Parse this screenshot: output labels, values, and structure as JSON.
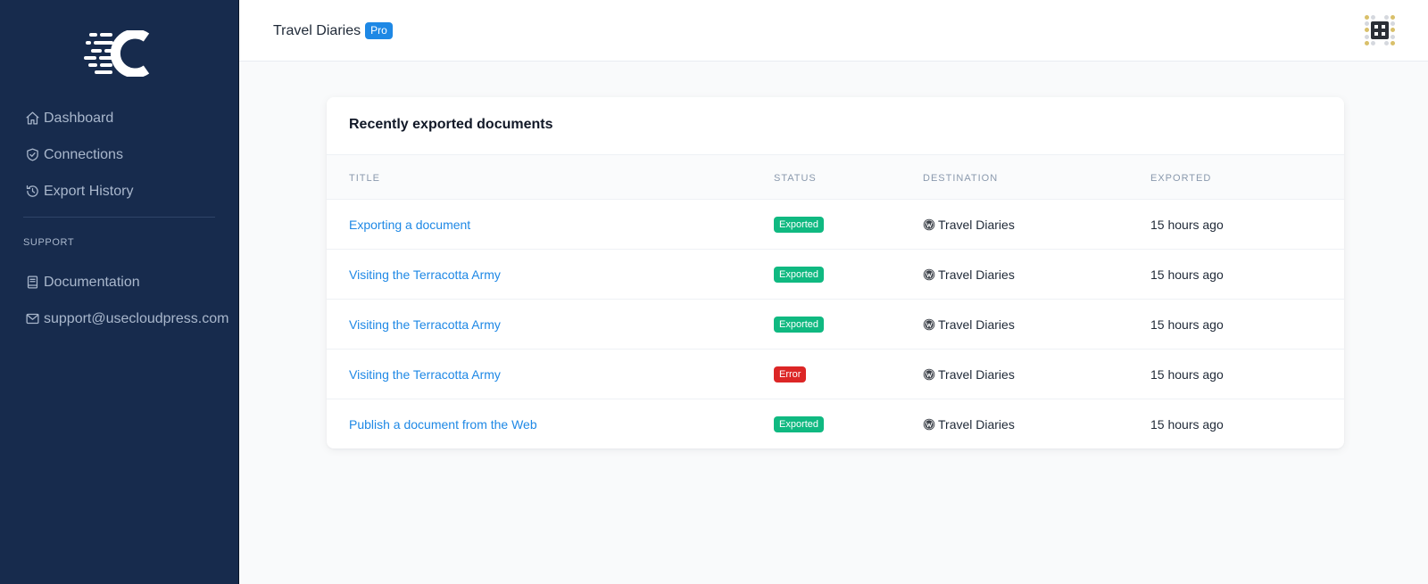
{
  "sidebar": {
    "nav": [
      {
        "label": "Dashboard",
        "icon": "home-icon"
      },
      {
        "label": "Connections",
        "icon": "shield-check-icon"
      },
      {
        "label": "Export History",
        "icon": "history-icon"
      }
    ],
    "support_label": "SUPPORT",
    "support": [
      {
        "label": "Documentation",
        "icon": "book-icon"
      },
      {
        "label": "support@usecloudpress.com",
        "icon": "mail-icon"
      }
    ]
  },
  "header": {
    "site_name": "Travel Diaries",
    "plan_badge": "Pro"
  },
  "card": {
    "title": "Recently exported documents",
    "columns": {
      "title": "TITLE",
      "status": "STATUS",
      "destination": "DESTINATION",
      "exported": "EXPORTED"
    },
    "rows": [
      {
        "title": "Exporting a document",
        "status": "Exported",
        "destination": "Travel Diaries",
        "exported": "15 hours ago"
      },
      {
        "title": "Visiting the Terracotta Army",
        "status": "Exported",
        "destination": "Travel Diaries",
        "exported": "15 hours ago"
      },
      {
        "title": "Visiting the Terracotta Army",
        "status": "Exported",
        "destination": "Travel Diaries",
        "exported": "15 hours ago"
      },
      {
        "title": "Visiting the Terracotta Army",
        "status": "Error",
        "destination": "Travel Diaries",
        "exported": "15 hours ago"
      },
      {
        "title": "Publish a document from the Web",
        "status": "Exported",
        "destination": "Travel Diaries",
        "exported": "15 hours ago"
      }
    ]
  },
  "colors": {
    "sidebar_bg": "#172b4d",
    "accent": "#1e88e5",
    "status_exported": "#10b981",
    "status_error": "#dc2626"
  }
}
